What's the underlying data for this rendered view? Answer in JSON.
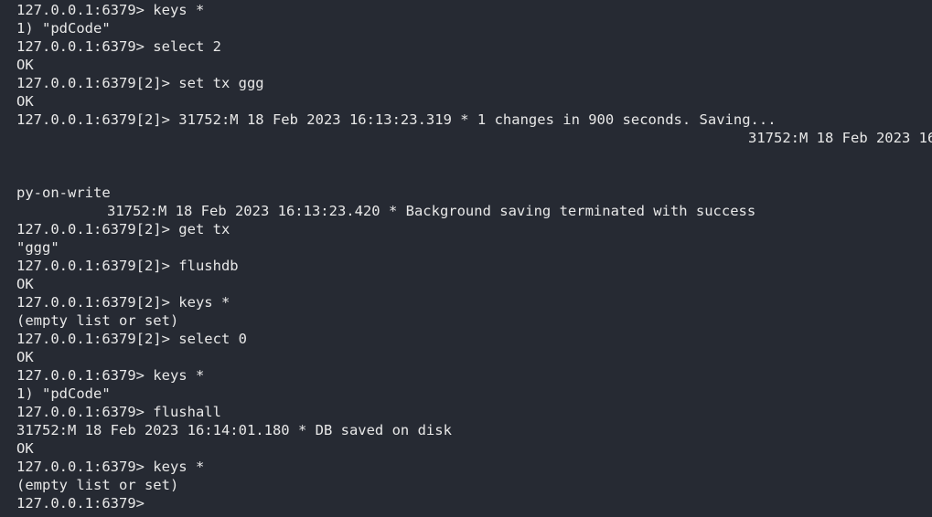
{
  "terminal": {
    "lines": [
      "127.0.0.1:6379> keys *",
      "1) \"pdCode\"",
      "127.0.0.1:6379> select 2",
      "OK",
      "127.0.0.1:6379[2]> set tx ggg",
      "OK",
      "127.0.0.1:6379[2]> 31752:M 18 Feb 2023 16:13:23.319 * 1 changes in 900 seconds. Saving...",
      "31752:M 18 Feb 2023 16",
      "",
      "",
      "py-on-write",
      "31752:M 18 Feb 2023 16:13:23.420 * Background saving terminated with success",
      "127.0.0.1:6379[2]> get tx",
      "\"ggg\"",
      "127.0.0.1:6379[2]> flushdb",
      "OK",
      "127.0.0.1:6379[2]> keys *",
      "(empty list or set)",
      "127.0.0.1:6379[2]> select 0",
      "OK",
      "127.0.0.1:6379> keys *",
      "1) \"pdCode\"",
      "127.0.0.1:6379> flushall",
      "31752:M 18 Feb 2023 16:14:01.180 * DB saved on disk",
      "OK",
      "127.0.0.1:6379> keys *",
      "(empty list or set)",
      "127.0.0.1:6379> "
    ]
  }
}
